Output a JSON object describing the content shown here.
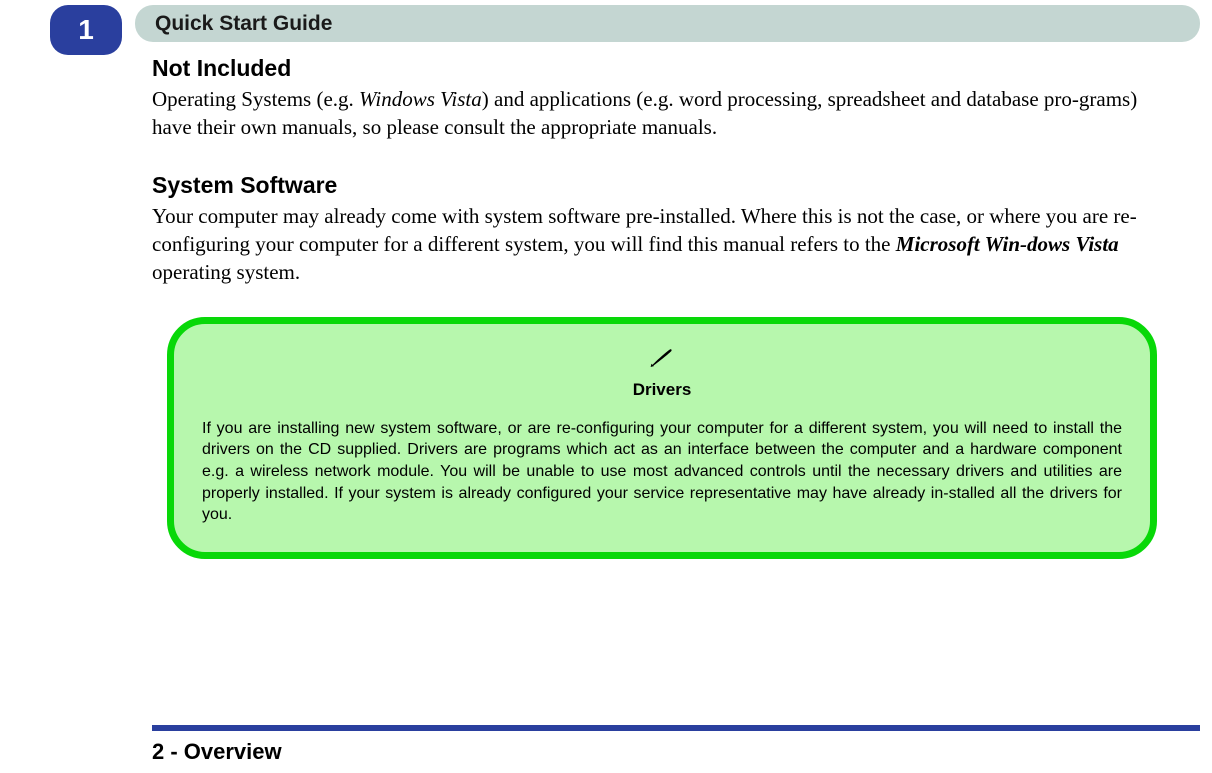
{
  "tab_number": "1",
  "header_title": "Quick Start Guide",
  "sections": {
    "not_included": {
      "heading": "Not Included",
      "body_pre": "Operating Systems (e.g. ",
      "body_italic": "Windows Vista",
      "body_post": ") and applications (e.g. word processing, spreadsheet and database pro-grams) have their own manuals, so please consult the appropriate manuals."
    },
    "system_software": {
      "heading": "System Software",
      "body_pre": "Your computer may already come with system software pre-installed. Where this is not the case, or where you are re-configuring your computer for a different system, you will find this manual refers to the ",
      "body_bolditalic": "Microsoft Win-dows Vista",
      "body_post": " operating system."
    }
  },
  "callout": {
    "icon_name": "pen-icon",
    "title": "Drivers",
    "body": "If you are installing new system software, or are re-configuring your computer for a different system, you will need to install the drivers on the CD supplied. Drivers are programs which act as an interface between the computer and a hardware component e.g. a wireless network module. You will be unable to use most advanced controls until the necessary drivers and utilities are properly installed. If your system is already configured your service representative may have already in-stalled all the drivers for you."
  },
  "footer": "2 - Overview"
}
